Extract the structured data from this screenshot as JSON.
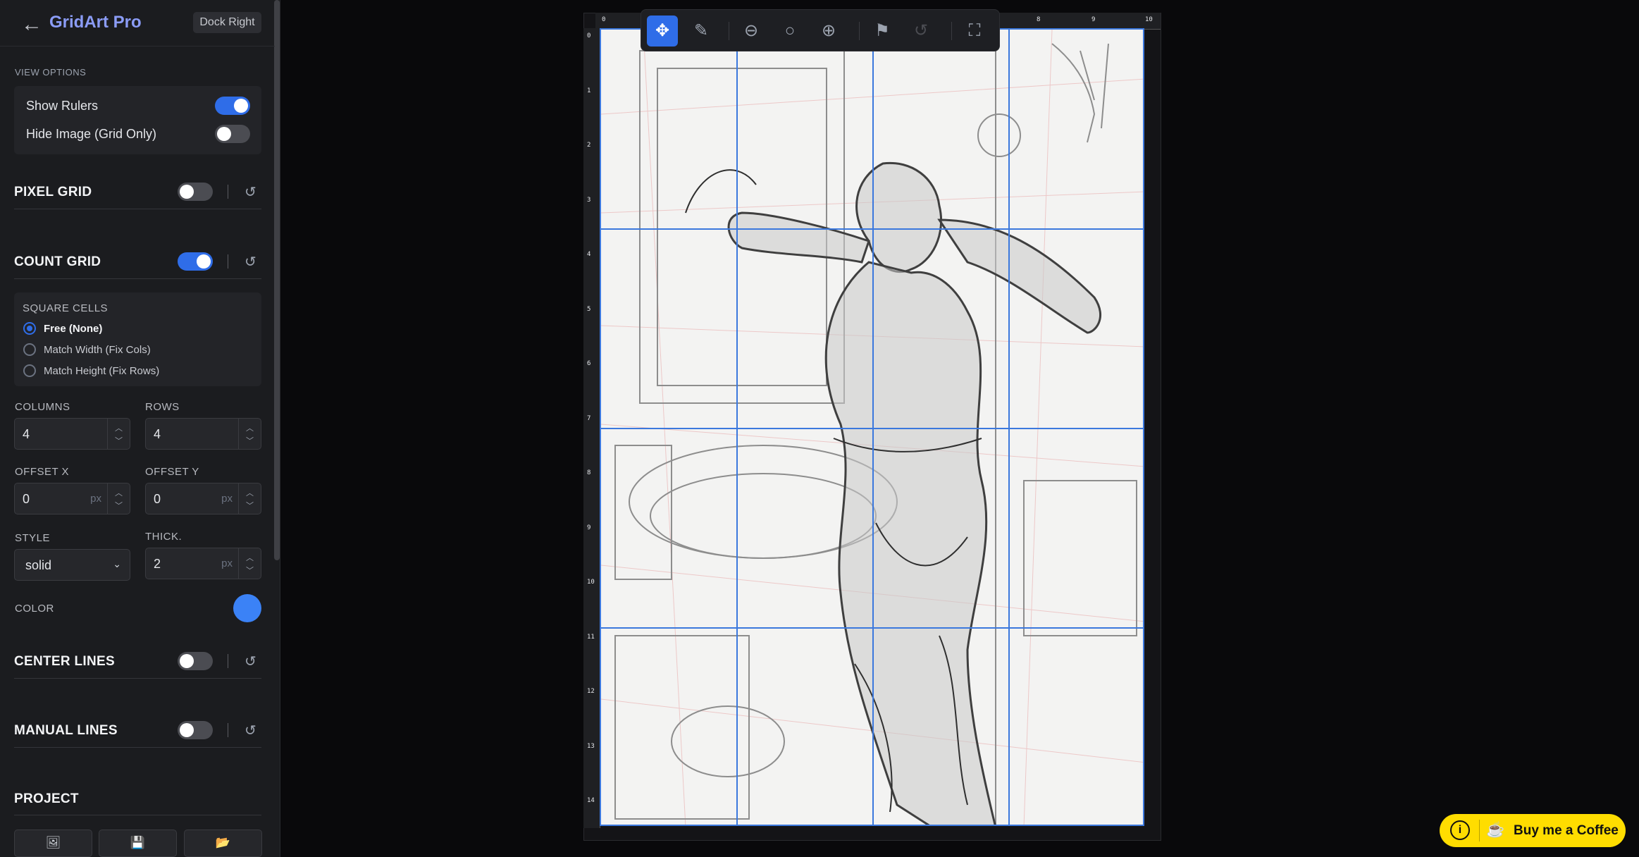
{
  "app": {
    "title": "GridArt Pro",
    "dock_label": "Dock Right"
  },
  "view_options": {
    "heading": "VIEW OPTIONS",
    "show_rulers": {
      "label": "Show Rulers",
      "on": true
    },
    "hide_image": {
      "label": "Hide Image (Grid Only)",
      "on": false
    }
  },
  "sections": {
    "pixel_grid": {
      "title": "PIXEL GRID",
      "on": false
    },
    "count_grid": {
      "title": "COUNT GRID",
      "on": true
    },
    "center_lines": {
      "title": "CENTER LINES",
      "on": false
    },
    "manual_lines": {
      "title": "MANUAL LINES",
      "on": false
    },
    "project": {
      "title": "PROJECT"
    }
  },
  "square_cells": {
    "heading": "SQUARE CELLS",
    "options": [
      "Free (None)",
      "Match Width (Fix Cols)",
      "Match Height (Fix Rows)"
    ],
    "selected": "Free (None)"
  },
  "fields": {
    "columns": {
      "label": "COLUMNS",
      "value": "4"
    },
    "rows": {
      "label": "ROWS",
      "value": "4"
    },
    "offset_x": {
      "label": "OFFSET X",
      "value": "0",
      "unit": "px"
    },
    "offset_y": {
      "label": "OFFSET Y",
      "value": "0",
      "unit": "px"
    },
    "style": {
      "label": "STYLE",
      "value": "solid"
    },
    "thickness": {
      "label": "THICK.",
      "value": "2",
      "unit": "px"
    },
    "color": {
      "label": "COLOR",
      "value": "#3b82f6"
    }
  },
  "rulers": {
    "top": [
      "0",
      "8",
      "9",
      "10"
    ],
    "left": [
      "0",
      "1",
      "2",
      "3",
      "4",
      "5",
      "6",
      "7",
      "8",
      "9",
      "10",
      "11",
      "12",
      "13",
      "14"
    ]
  },
  "toolbar": {
    "tools": [
      "move-icon",
      "pencil-icon",
      "zoom-out-icon",
      "zoom-reset-icon",
      "zoom-in-icon",
      "bookmark-icon",
      "undo-icon",
      "fullscreen-icon"
    ],
    "active": "move-icon"
  },
  "coffee": {
    "label": "Buy me a Coffee"
  },
  "colors": {
    "accent": "#2f6de8",
    "grid": "#3b78dd",
    "coffee": "#ffdd00"
  }
}
